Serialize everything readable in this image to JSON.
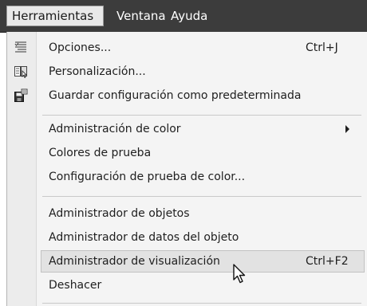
{
  "menubar": {
    "items": [
      {
        "label": "Herramientas",
        "state": "open"
      },
      {
        "label": "Ventana"
      },
      {
        "label": "Ayuda"
      }
    ]
  },
  "menu": {
    "items": [
      {
        "label": "Opciones...",
        "shortcut": "Ctrl+J",
        "icon": "options-list-icon"
      },
      {
        "label": "Personalización...",
        "icon": "customize-icon"
      },
      {
        "label": "Guardar configuración como predeterminada",
        "icon": "save-settings-icon"
      },
      {
        "label": "Administración de color",
        "submenu": true
      },
      {
        "label": "Colores de prueba"
      },
      {
        "label": "Configuración de prueba de color..."
      },
      {
        "label": "Administrador de objetos"
      },
      {
        "label": "Administrador de datos del objeto"
      },
      {
        "label": "Administrador de visualización",
        "shortcut": "Ctrl+F2",
        "highlighted": true
      },
      {
        "label": "Deshacer"
      }
    ]
  },
  "colors": {
    "menubar_bg": "#3c3c3c",
    "menu_bg": "#f4f4f4",
    "highlight_bg": "#e2e2e2"
  }
}
